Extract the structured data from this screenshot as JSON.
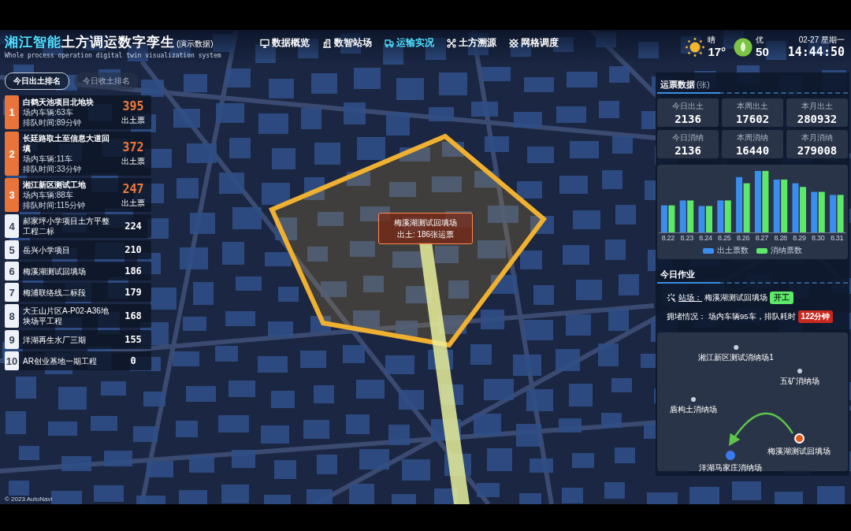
{
  "header": {
    "title_highlight": "湘江智能",
    "title": "土方调运数字孪生",
    "title_note": "(演示数据)",
    "subtitle": "Whole process operation digital twin visualization system"
  },
  "nav": [
    {
      "label": "数据概览",
      "selected": false
    },
    {
      "label": "数智站场",
      "selected": false
    },
    {
      "label": "运输实况",
      "selected": true
    },
    {
      "label": "土方溯源",
      "selected": false
    },
    {
      "label": "网格调度",
      "selected": false
    }
  ],
  "weather": {
    "condition": "晴",
    "temperature": "17°"
  },
  "air": {
    "quality": "优",
    "aqi": "50"
  },
  "datetime": {
    "date": "02-27 星期一",
    "time": "14:44:50"
  },
  "ranking_tabs": [
    {
      "label": "今日出土排名",
      "selected": true
    },
    {
      "label": "今日收土排名",
      "selected": false
    }
  ],
  "ranking": [
    {
      "rank": "1",
      "name": "白鹤天池项目北地块",
      "vehicles": "场内车辆:63车",
      "queue": "排队时间:89分钟",
      "count": "395",
      "count_label": "出土票",
      "highlighted": true
    },
    {
      "rank": "2",
      "name": "长廷路取土至信息大道回填",
      "vehicles": "场内车辆:11车",
      "queue": "排队时间:33分钟",
      "count": "372",
      "count_label": "出土票",
      "highlighted": true
    },
    {
      "rank": "3",
      "name": "湘江新区测试工地",
      "vehicles": "场内车辆:88车",
      "queue": "排队时间:115分钟",
      "count": "247",
      "count_label": "出土票",
      "highlighted": true
    },
    {
      "rank": "4",
      "name": "郝家坪小学项目土方平整工程二标",
      "count": "224",
      "highlighted": false
    },
    {
      "rank": "5",
      "name": "岳兴小学项目",
      "count": "210",
      "highlighted": false
    },
    {
      "rank": "6",
      "name": "梅溪湖测试回填场",
      "count": "186",
      "highlighted": false
    },
    {
      "rank": "7",
      "name": "梅浦联络线二标段",
      "count": "179",
      "highlighted": false
    },
    {
      "rank": "8",
      "name": "大王山片区A-P02-A36地块场平工程",
      "count": "168",
      "highlighted": false
    },
    {
      "rank": "9",
      "name": "洋湖再生水厂三期",
      "count": "155",
      "highlighted": false
    },
    {
      "rank": "10",
      "name": "AR创业基地一期工程",
      "count": "0",
      "highlighted": false
    }
  ],
  "map": {
    "popup": {
      "title": "梅溪湖测试回填场",
      "text": "出土: 186张运票"
    },
    "attribution": "© 2023 AutoNavi"
  },
  "ticket_data": {
    "title": "运票数据",
    "unit": "(张)",
    "stats": [
      {
        "label": "今日出土",
        "value": "2136"
      },
      {
        "label": "本周出土",
        "value": "17602"
      },
      {
        "label": "本月出土",
        "value": "280932"
      },
      {
        "label": "今日消纳",
        "value": "2136"
      },
      {
        "label": "本周消纳",
        "value": "16440"
      },
      {
        "label": "本月消纳",
        "value": "279008"
      }
    ]
  },
  "daily_chart": {
    "x_labels": [
      "8.22",
      "8.23",
      "8.24",
      "8.25",
      "8.26",
      "8.27",
      "8.28",
      "8.29",
      "8.30",
      "8.31"
    ],
    "legend": [
      {
        "label": "出土票数",
        "color": "#3a8ef0"
      },
      {
        "label": "消纳票数",
        "color": "#5ee86a"
      }
    ]
  },
  "today_work": {
    "title": "今日作业",
    "station_label": "站场：",
    "station": "梅溪湖测试回填场",
    "status": "开工",
    "congestion_label": "拥堵情况：",
    "congestion": "场内车辆95车，排队耗时",
    "queue_time": "122分钟"
  },
  "route_map": {
    "sites": [
      {
        "name": "湘江新区测试消纳场1",
        "kind": "site"
      },
      {
        "name": "五矿消纳场",
        "kind": "site"
      },
      {
        "name": "盾构土消纳场",
        "kind": "site"
      },
      {
        "name": "梅溪湖测试回填场",
        "kind": "origin"
      },
      {
        "name": "洋湖马家庄消纳场",
        "kind": "destination"
      }
    ]
  }
}
